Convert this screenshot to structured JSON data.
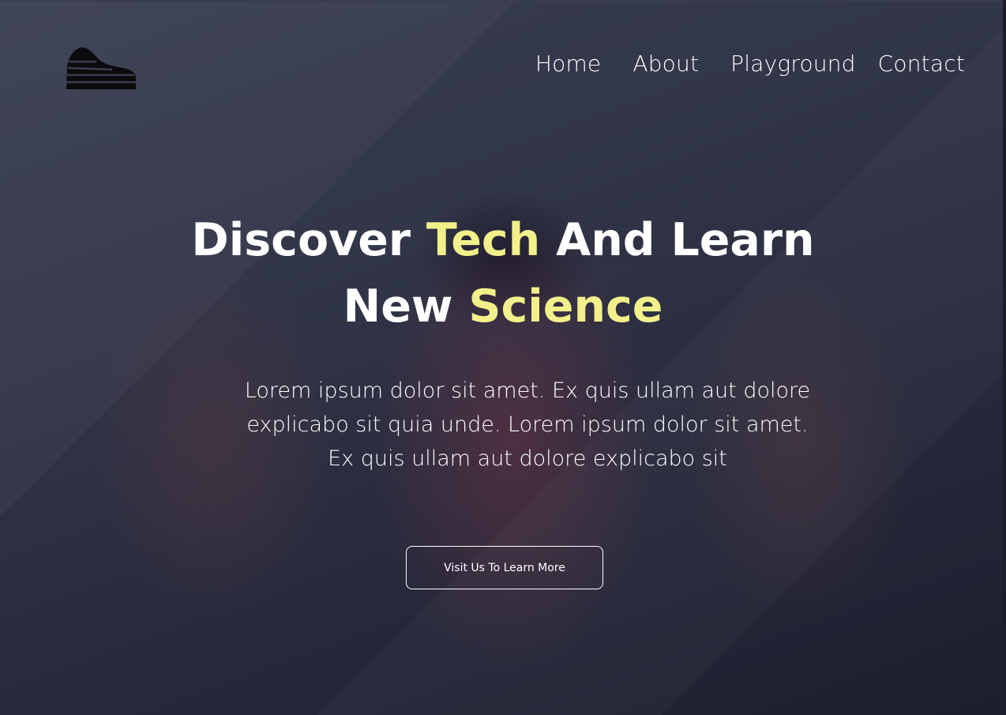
{
  "nav": {
    "items": [
      "Home",
      "About",
      "Playground",
      "Contact"
    ]
  },
  "hero": {
    "title_word1": "Discover",
    "title_word2": "Tech",
    "title_word3": "And Learn",
    "title_word4": "New",
    "title_word5": "Science",
    "description": "Lorem ipsum dolor sit amet. Ex quis ullam aut dolore explicabo sit quia unde. Lorem ipsum dolor sit amet. Ex quis ullam aut dolore explicabo sit",
    "cta_label": "Visit Us To Learn More"
  },
  "colors": {
    "accent": "#f2f08a",
    "text": "#ffffff"
  },
  "icons": {
    "logo": "sneaker-logo-icon"
  }
}
